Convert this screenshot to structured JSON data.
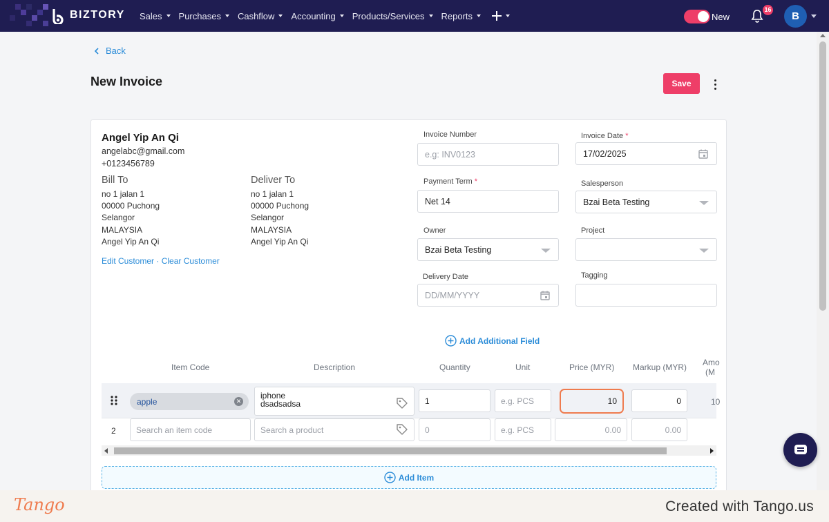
{
  "app": {
    "brand": "BIZTORY",
    "nav": [
      "Sales",
      "Purchases",
      "Cashflow",
      "Accounting",
      "Products/Services",
      "Reports"
    ],
    "toggle_label": "New",
    "notification_count": "16",
    "avatar_initial": "B"
  },
  "page": {
    "back_label": "Back",
    "title": "New Invoice",
    "save_label": "Save"
  },
  "customer": {
    "name": "Angel Yip An Qi",
    "email": "angelabc@gmail.com",
    "phone": "+0123456789",
    "bill_to_label": "Bill To",
    "deliver_to_label": "Deliver To",
    "bill_to": [
      "no 1 jalan 1",
      "00000 Puchong",
      "Selangor",
      "MALAYSIA",
      "Angel Yip An Qi"
    ],
    "deliver_to": [
      "no 1 jalan 1",
      "00000 Puchong",
      "Selangor",
      "MALAYSIA",
      "Angel Yip An Qi"
    ],
    "edit_label": "Edit Customer",
    "separator": "·",
    "clear_label": "Clear Customer"
  },
  "form": {
    "invoice_number_label": "Invoice Number",
    "invoice_number_placeholder": "e.g: INV0123",
    "invoice_date_label": "Invoice Date",
    "invoice_date_value": "17/02/2025",
    "payment_term_label": "Payment Term",
    "payment_term_value": "Net 14",
    "salesperson_label": "Salesperson",
    "salesperson_value": "Bzai Beta Testing",
    "owner_label": "Owner",
    "owner_value": "Bzai Beta Testing",
    "project_label": "Project",
    "project_value": "",
    "delivery_date_label": "Delivery Date",
    "delivery_date_placeholder": "DD/MM/YYYY",
    "tagging_label": "Tagging",
    "required_mark": "*",
    "add_field_label": "Add Additional Field"
  },
  "items": {
    "columns": [
      "Item Code",
      "Description",
      "Quantity",
      "Unit",
      "Price (MYR)",
      "Markup (MYR)"
    ],
    "amount_col_cut": [
      "Amo",
      "(M"
    ],
    "rows": [
      {
        "code": "apple",
        "description_1": "iphone",
        "description_2": "dsadsadsa",
        "quantity": "1",
        "unit_placeholder": "e.g. PCS",
        "price": "10",
        "markup": "0",
        "amount_cut": "10"
      },
      {
        "number": "2",
        "code_placeholder": "Search an item code",
        "description_placeholder": "Search a product",
        "quantity_placeholder": "0",
        "unit_placeholder": "e.g. PCS",
        "price_placeholder": "0.00",
        "markup_placeholder": "0.00"
      }
    ],
    "add_item_label": "Add Item"
  },
  "footer": {
    "tango": "Tango",
    "created_with": "Created with Tango.us"
  },
  "colors": {
    "nav_bg": "#1f1d52",
    "accent": "#ee3e68",
    "link": "#2b8cd8",
    "highlight": "#ef7b4e"
  }
}
